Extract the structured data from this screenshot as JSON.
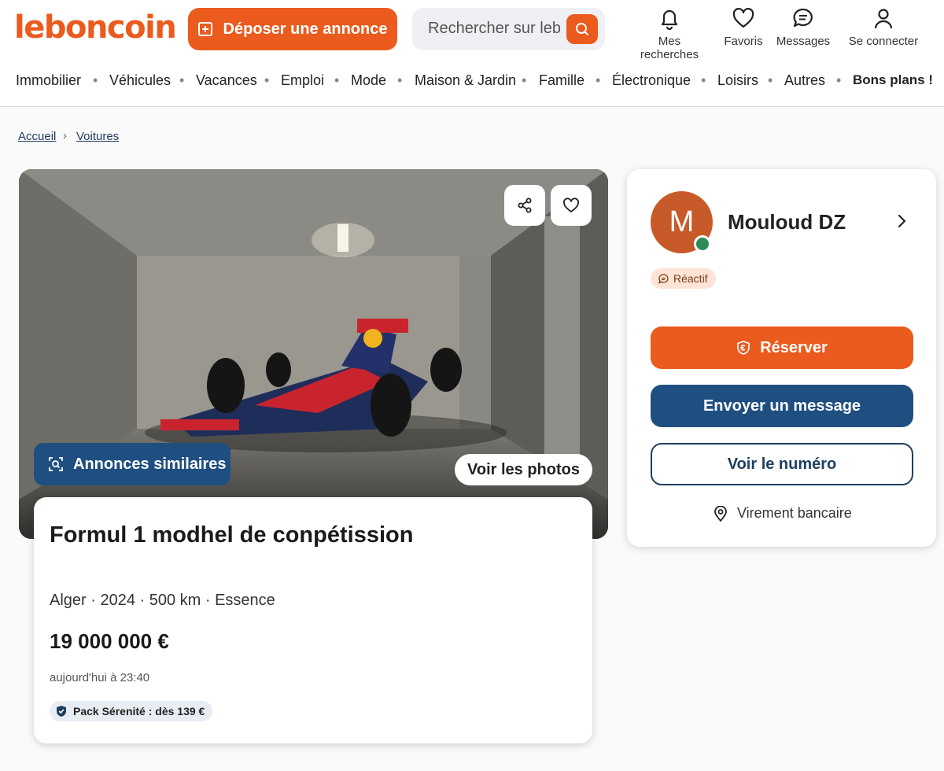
{
  "header": {
    "logo": "leboncoin",
    "post_button": "Déposer une annonce",
    "search_placeholder": "Rechercher sur lebi",
    "links": [
      {
        "label": "Mes recherches",
        "icon": "bell-icon"
      },
      {
        "label": "Favoris",
        "icon": "heart-icon"
      },
      {
        "label": "Messages",
        "icon": "chat-icon"
      },
      {
        "label": "Se connecter",
        "icon": "user-icon"
      }
    ],
    "accent_color": "#ea5b1d"
  },
  "categories": [
    "Immobilier",
    "Véhicules",
    "Vacances",
    "Emploi",
    "Mode",
    "Maison & Jardin",
    "Famille",
    "Électronique",
    "Loisirs",
    "Autres",
    "Bons plans !"
  ],
  "breadcrumb": [
    "Accueil",
    "Voitures"
  ],
  "listing": {
    "similar_button": "Annonces similaires",
    "photos_button": "Voir les photos",
    "title": "Formul 1 modhel de conpétission",
    "meta": "Alger · 2024 · 500 km · Essence",
    "price": "19 000 000 €",
    "date": "aujourd'hui à 23:40",
    "pack": "Pack Sérenité : dès 139 €"
  },
  "seller": {
    "initial": "M",
    "name": "Mouloud DZ",
    "badge": "Réactif",
    "reserve_button": "Réserver",
    "message_button": "Envoyer un message",
    "phone_button": "Voir le numéro",
    "payment": "Virement bancaire",
    "brand_blue": "#1f4f80"
  }
}
